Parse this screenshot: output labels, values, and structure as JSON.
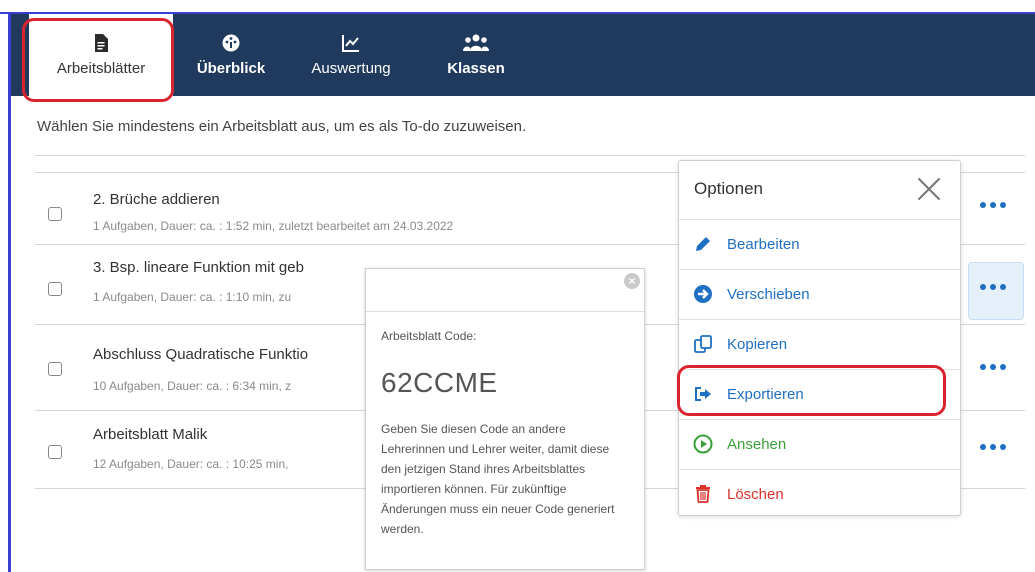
{
  "colors": {
    "nav_bg": "#1f3a5c",
    "accent": "#1f6fc2",
    "highlight": "#d9232d",
    "view_green": "#3aa03a",
    "delete_red": "#d9342b"
  },
  "nav": {
    "items": [
      {
        "label": "Arbeitsblätter",
        "icon": "document-icon"
      },
      {
        "label": "Überblick",
        "icon": "dashboard-icon"
      },
      {
        "label": "Auswertung",
        "icon": "chart-icon"
      },
      {
        "label": "Klassen",
        "icon": "users-icon"
      }
    ]
  },
  "main": {
    "subtitle": "Wählen Sie mindestens ein Arbeitsblatt aus, um es als To-do zuzuweisen.",
    "rows": [
      {
        "title": "2. Brüche addieren",
        "meta": "1 Aufgaben, Dauer: ca. : 1:52 min, zuletzt bearbeitet am 24.03.2022"
      },
      {
        "title": "3. Bsp. lineare Funktion mit geb",
        "meta": "1 Aufgaben, Dauer: ca. : 1:10 min, zu"
      },
      {
        "title": "Abschluss Quadratische Funktio",
        "meta": "10 Aufgaben, Dauer: ca. : 6:34 min, z"
      },
      {
        "title": "Arbeitsblatt Malik",
        "meta": "12 Aufgaben, Dauer: ca. : 10:25 min,"
      }
    ]
  },
  "code_popup": {
    "label": "Arbeitsblatt Code:",
    "code": "62CCME",
    "text": "Geben Sie diesen Code an andere Lehrerinnen und Lehrer weiter, damit diese den jetzigen Stand ihres Arbeitsblattes importieren können. Für zukünftige Änderungen muss ein neuer Code generiert werden."
  },
  "options": {
    "title": "Optionen",
    "items": [
      {
        "label": "Bearbeiten",
        "icon": "pencil-icon"
      },
      {
        "label": "Verschieben",
        "icon": "arrow-right-circle-icon"
      },
      {
        "label": "Kopieren",
        "icon": "copy-icon"
      },
      {
        "label": "Exportieren",
        "icon": "export-icon"
      },
      {
        "label": "Ansehen",
        "icon": "play-circle-icon"
      },
      {
        "label": "Löschen",
        "icon": "trash-icon"
      }
    ]
  }
}
